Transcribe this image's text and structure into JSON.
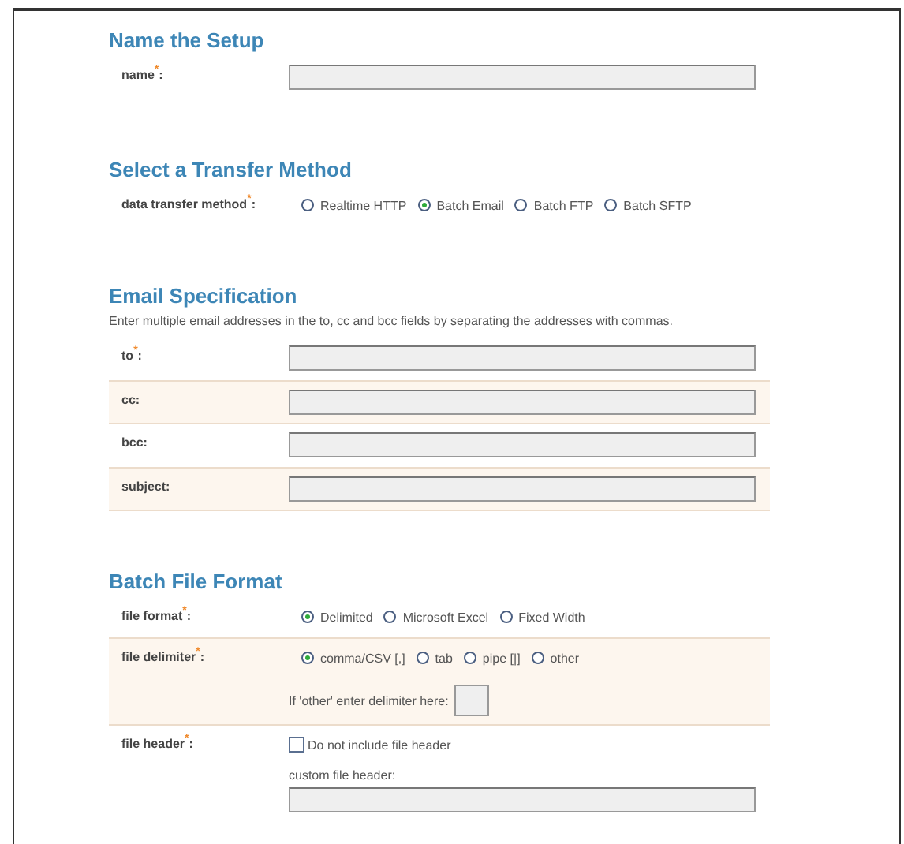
{
  "sections": [
    {
      "title": "Name the Setup",
      "rows": [
        {
          "kind": "text",
          "label": "name$^{*}$:",
          "shaded": false
        }
      ]
    },
    {
      "title": "Select a Transfer Method",
      "rows": [
        {
          "kind": "radio",
          "label": "data transfer method$^{*}$:",
          "shaded": false,
          "options": [
            {
              "label": "Realtime HTTP",
              "selected": false
            },
            {
              "label": "Batch Email",
              "selected": true
            },
            {
              "label": "Batch FTP",
              "selected": false
            },
            {
              "label": "Batch SFTP",
              "selected": false
            }
          ]
        }
      ]
    },
    {
      "title": "Email Specification",
      "description": "Enter multiple email addresses in the to, cc and bcc fields by separating the addresses with commas.",
      "rows": [
        {
          "kind": "text",
          "label": "to$^{*}$:",
          "shaded": false
        },
        {
          "kind": "text",
          "label": "cc:",
          "shaded": true
        },
        {
          "kind": "text",
          "label": "bcc:",
          "shaded": false
        },
        {
          "kind": "text",
          "label": "subject:",
          "shaded": true
        }
      ]
    },
    {
      "title": "Batch File Format",
      "rows": [
        {
          "kind": "radio",
          "label": "file format$^{*}$:",
          "shaded": false,
          "options": [
            {
              "label": "Delimited",
              "selected": true
            },
            {
              "label": "Microsoft Excel",
              "selected": false
            },
            {
              "label": "Fixed Width",
              "selected": false
            }
          ]
        },
        {
          "kind": "radio",
          "label": "file delimiter$^{*}$:",
          "shaded": true,
          "options": [
            {
              "label": "comma/CSV [,]",
              "selected": true
            },
            {
              "label": "tab",
              "selected": false
            },
            {
              "label": "pipe [|]",
              "selected": false
            },
            {
              "label": "other",
              "selected": false
            }
          ],
          "extra_field": "If 'other' enter delimiter here:"
        },
        {
          "kind": "checkbox",
          "label": "file header$^{*}$:",
          "shaded": false,
          "checkbox": {
            "label": "Do not include file header",
            "checked": false
          },
          "field_label": "custom file header:"
        }
      ]
    }
  ]
}
